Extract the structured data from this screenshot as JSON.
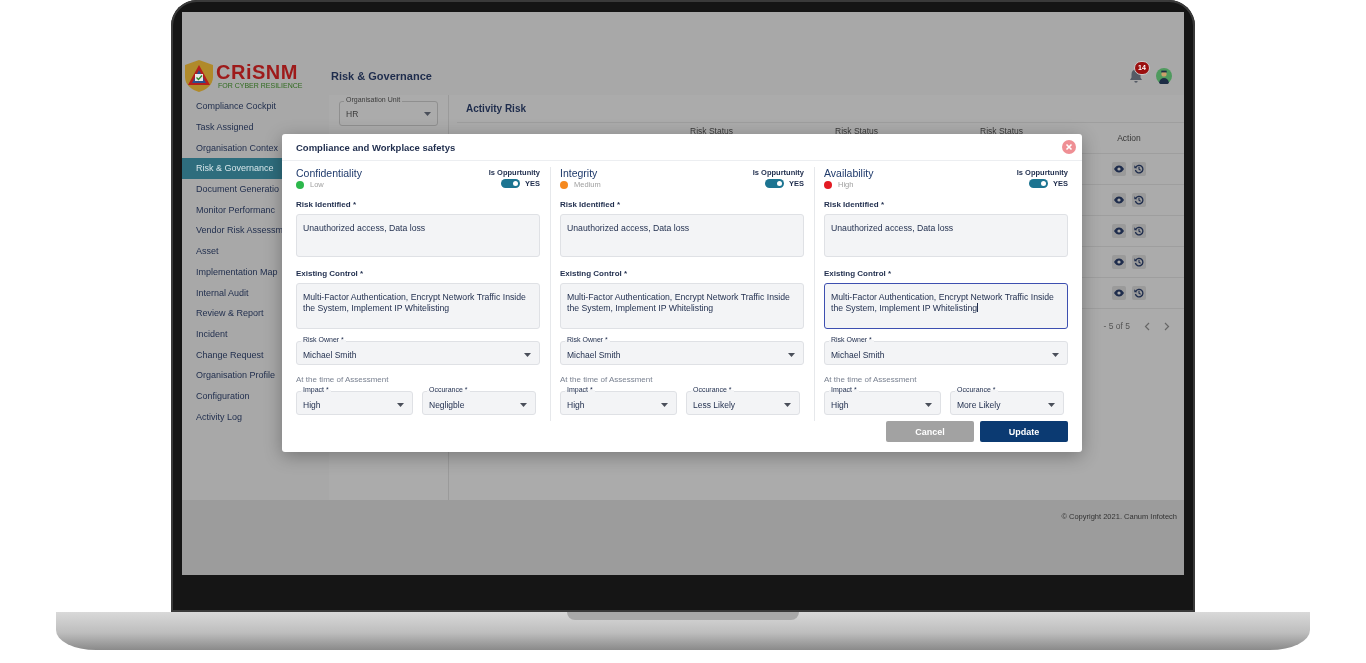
{
  "header": {
    "logo": {
      "name": "CRiSNM",
      "tagline": "FOR CYBER RESILIENCE"
    },
    "page_title": "Risk & Governance",
    "notification_count": "14"
  },
  "sidebar": {
    "items": [
      {
        "label": "Compliance Cockpit",
        "selected": false
      },
      {
        "label": "Task Assigned",
        "selected": false
      },
      {
        "label": "Organisation Contex",
        "selected": false
      },
      {
        "label": "Risk & Governance",
        "selected": true
      },
      {
        "label": "Document Generatio",
        "selected": false
      },
      {
        "label": "Monitor Performanc",
        "selected": false
      },
      {
        "label": "Vendor Risk Assessm",
        "selected": false
      },
      {
        "label": "Asset",
        "selected": false
      },
      {
        "label": "Implementation Map",
        "selected": false
      },
      {
        "label": "Internal Audit",
        "selected": false
      },
      {
        "label": "Review & Report",
        "selected": false
      },
      {
        "label": "Incident",
        "selected": false
      },
      {
        "label": "Change Request",
        "selected": false
      },
      {
        "label": "Organisation Profile",
        "selected": false
      },
      {
        "label": "Configuration",
        "selected": false
      },
      {
        "label": "Activity Log",
        "selected": false
      }
    ]
  },
  "filter": {
    "label": "Organisation Unit",
    "value": "HR"
  },
  "activity_risk": {
    "title": "Activity Risk",
    "columns": [
      {
        "label": "Risk Status"
      },
      {
        "label": "Risk Status"
      },
      {
        "label": "Risk Status"
      },
      {
        "label": "Action"
      }
    ],
    "rows": [
      {
        "kind": "actions"
      },
      {
        "kind": "actions"
      },
      {
        "kind": "actions"
      },
      {
        "kind": "actions"
      },
      {
        "kind": "actions"
      }
    ],
    "pagination": "- 5 of 5"
  },
  "footer": {
    "copyright": "© Copyright 2021. Canum Infotech"
  },
  "modal": {
    "title": "Compliance and Workplace safetys",
    "sections": [
      {
        "name": "Confidentiality",
        "risk_level": "Low",
        "color": "#2db84c",
        "opportunity_label": "Is Oppurtunity",
        "opportunity_on": true,
        "opportunity_value": "YES",
        "risk_label": "Risk Identified *",
        "risk_value": "Unauthorized access, Data loss",
        "control_label": "Existing Control *",
        "control_value": "Multi-Factor Authentication, Encrypt Network Traffic Inside the System, Implement IP Whitelisting",
        "focused": false,
        "owner_label": "Risk Owner *",
        "owner_value": "Michael Smith",
        "assessment_label": "At the time of Assessment",
        "impact_label": "Impact *",
        "impact_value": "High",
        "occurrence_label": "Occurance *",
        "occurrence_value": "Negligble"
      },
      {
        "name": "Integrity",
        "risk_level": "Medium",
        "color": "#f5891f",
        "opportunity_label": "Is Oppurtunity",
        "opportunity_on": true,
        "opportunity_value": "YES",
        "risk_label": "Risk Identified *",
        "risk_value": "Unauthorized access, Data loss",
        "control_label": "Existing Control *",
        "control_value": "Multi-Factor Authentication, Encrypt Network Traffic Inside the System, Implement IP Whitelisting",
        "focused": false,
        "owner_label": "Risk Owner *",
        "owner_value": "Michael Smith",
        "assessment_label": "At the time of Assessment",
        "impact_label": "Impact *",
        "impact_value": "High",
        "occurrence_label": "Occurance *",
        "occurrence_value": "Less Likely"
      },
      {
        "name": "Availability",
        "risk_level": "High",
        "color": "#e31b23",
        "opportunity_label": "Is Oppurtunity",
        "opportunity_on": true,
        "opportunity_value": "YES",
        "risk_label": "Risk Identified *",
        "risk_value": "Unauthorized access, Data loss",
        "control_label": "Existing Control *",
        "control_value": "Multi-Factor Authentication, Encrypt Network Traffic Inside the System, Implement IP Whitelisting",
        "focused": true,
        "owner_label": "Risk Owner *",
        "owner_value": "Michael Smith",
        "assessment_label": "At the time of Assessment",
        "impact_label": "Impact *",
        "impact_value": "High",
        "occurrence_label": "Occurance *",
        "occurrence_value": "More Likely"
      }
    ],
    "buttons": [
      {
        "label": "Cancel",
        "kind": "secondary"
      },
      {
        "label": "Update",
        "kind": "primary"
      }
    ]
  }
}
